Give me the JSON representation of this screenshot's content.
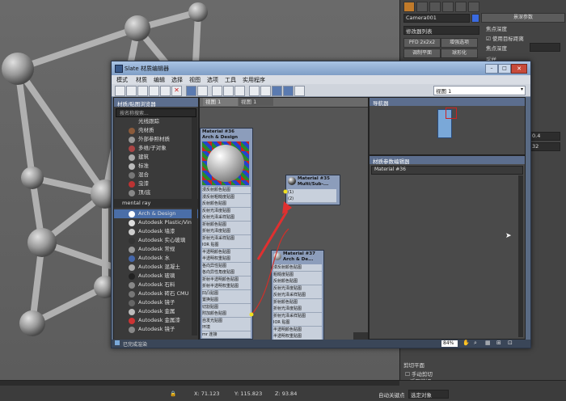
{
  "right_panel": {
    "camera_name": "Camera001",
    "modifier_list": "修改器列表",
    "btn_pfd": "PFD 2x2x2",
    "btn_lighting": "增强选项",
    "btn_flat": "调制平面",
    "btn_spherize": "球形化",
    "section_title": "景深参数",
    "focal_depth": "焦点深度",
    "use_target": "使用目标距离",
    "focus_depth_label": "焦点深度",
    "sampling": "采样",
    "val_1": "0.4",
    "val_2": "32",
    "clip_plane": "剪切平面",
    "manual_clip": "手动剪切",
    "near_clip": "近距剪切",
    "near_val": "1.0"
  },
  "slate": {
    "title": "Slate 材质编辑器",
    "menus": [
      "模式",
      "材质",
      "编辑",
      "选择",
      "视图",
      "选项",
      "工具",
      "实用程序"
    ],
    "view_select": "视图 1",
    "browser_title": "材质/贴图浏览器",
    "search_placeholder": "按名称搜索...",
    "tab1": "视图 1",
    "tab2": "视图 1",
    "navigator_title": "导航器",
    "param_editor_title": "材质参数编辑器",
    "param_material": "Material #36",
    "zoom": "84%",
    "status": "已完成渲染",
    "browser_items": [
      {
        "label": "光线跟踪",
        "color": "#3a3a3a"
      },
      {
        "label": "壳材质",
        "color": "#8a5a3a"
      },
      {
        "label": "外部参照材质",
        "color": "#999999"
      },
      {
        "label": "多维/子对象",
        "color": "#aa4444"
      },
      {
        "label": "建筑",
        "color": "#aaaaaa"
      },
      {
        "label": "标准",
        "color": "#bbbbbb"
      },
      {
        "label": "混合",
        "color": "#777777"
      },
      {
        "label": "虫漆",
        "color": "#bb3333"
      },
      {
        "label": "顶/底",
        "color": "#888888"
      }
    ],
    "mr_group": "mental ray",
    "mr_items": [
      {
        "label": "Arch & Design",
        "color": "#ffffff",
        "selected": true
      },
      {
        "label": "Autodesk Plastic/Vinyl",
        "color": "#dddddd",
        "selected": false
      },
      {
        "label": "Autodesk 墙漆",
        "color": "#cccccc",
        "selected": false
      },
      {
        "label": "Autodesk 实心玻璃",
        "color": "#333333",
        "selected": false
      },
      {
        "label": "Autodesk 常规",
        "color": "#999999",
        "selected": false
      },
      {
        "label": "Autodesk 水",
        "color": "#4466aa",
        "selected": false
      },
      {
        "label": "Autodesk 混凝土",
        "color": "#aaaaaa",
        "selected": false
      },
      {
        "label": "Autodesk 玻璃",
        "color": "#222222",
        "selected": false
      },
      {
        "label": "Autodesk 石料",
        "color": "#888888",
        "selected": false
      },
      {
        "label": "Autodesk 砖石 CMU",
        "color": "#777777",
        "selected": false
      },
      {
        "label": "Autodesk 镜子",
        "color": "#666666",
        "selected": false
      },
      {
        "label": "Autodesk 金属",
        "color": "#bbbbbb",
        "selected": false
      },
      {
        "label": "Autodesk 金属漆",
        "color": "#cc3333",
        "selected": false
      },
      {
        "label": "Autodesk 镜子",
        "color": "#888888",
        "selected": false
      }
    ],
    "node36": {
      "title": "Material #36",
      "subtitle": "Arch & Design"
    },
    "node35": {
      "title": "Material #35",
      "subtitle": "Multi/Sub-..."
    },
    "node37": {
      "title": "Material #37",
      "subtitle": "Arch & De..."
    },
    "node36_slots": [
      "漫反射颜色贴图",
      "漫反射粗糙度贴图",
      "反射颜色贴图",
      "反射光泽度贴图",
      "反射光泽采样贴图",
      "折射颜色贴图",
      "折射光泽度贴图",
      "折射光泽采样贴图",
      "IOR 贴图",
      "半透明颜色贴图",
      "半透明权重贴图",
      "各向异性贴图",
      "各向异性角度贴图",
      "折射半透明颜色贴图",
      "折射半透明权重贴图",
      "凹凸贴图",
      "置换贴图",
      "切割贴图",
      "附加颜色贴图",
      "自发光贴图",
      "环境",
      "mr 连接"
    ],
    "node35_slots": [
      "(1)",
      "(2)"
    ],
    "node37_slots": [
      "漫反射颜色贴图",
      "粗糙度贴图",
      "反射颜色贴图",
      "反射光泽度贴图",
      "反射光泽采样贴图",
      "折射颜色贴图",
      "折射光泽度贴图",
      "折射光泽采样贴图",
      "IOR 贴图",
      "半透明颜色贴图",
      "半透明权重贴图",
      "各向异性贴图",
      "各向异性角度贴图",
      "折射半透明颜色贴图",
      "折射半透明权重贴图"
    ]
  },
  "status_bar": {
    "x_val": "71.123",
    "y_val": "115.823",
    "z_val": "93.84",
    "auto_key": "自动关键点",
    "selected": "选定对象"
  },
  "colors": {
    "slate_bg": "#5a6b84",
    "title_bar": "#8fb0d8",
    "selected_item": "#4a6ea8",
    "wire": "#d0302a",
    "arrow": "#e03030",
    "connector": "#f0e020"
  }
}
